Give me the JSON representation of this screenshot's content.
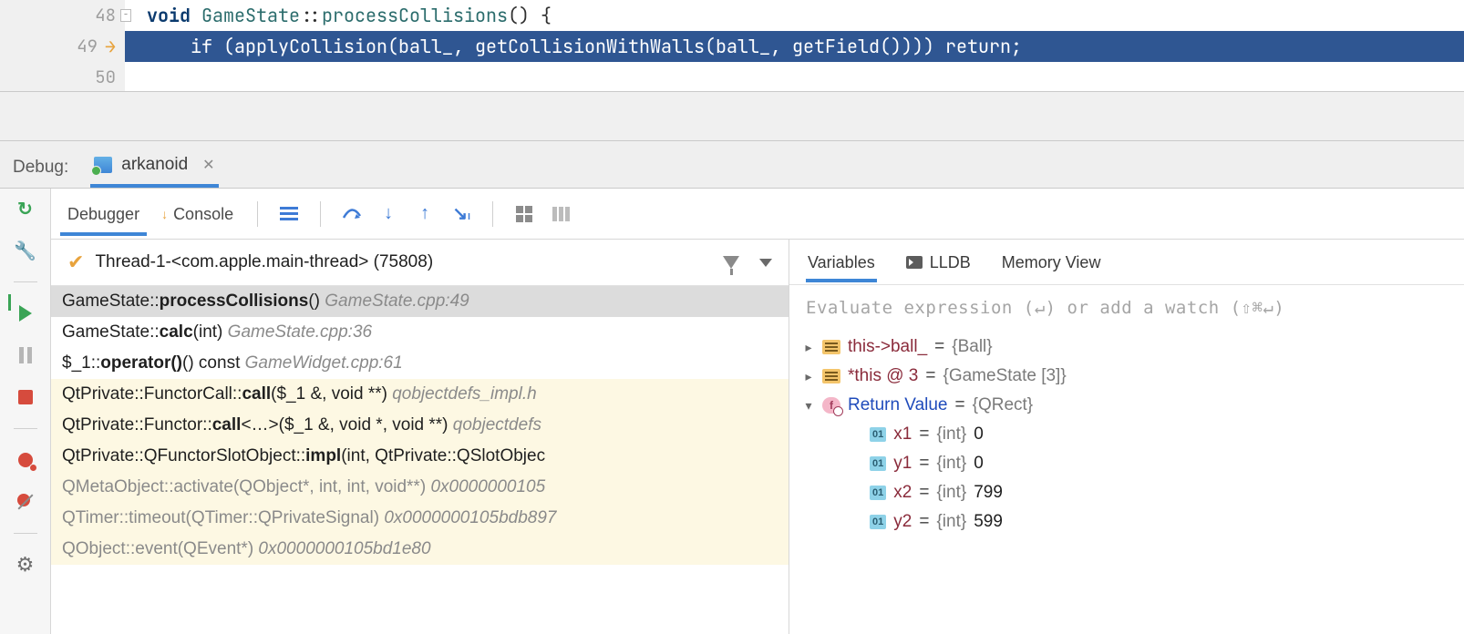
{
  "code": {
    "line48": {
      "num": "48",
      "kw": "void ",
      "cls": "GameState",
      "sep": "::",
      "fn": "processCollisions",
      "rest": "() {"
    },
    "line49": {
      "num": "49",
      "text": "    if (applyCollision(ball_, getCollisionWithWalls(ball_, getField()))) return;"
    },
    "line50": {
      "num": "50"
    }
  },
  "debug": {
    "label": "Debug:",
    "config": "arkanoid"
  },
  "tabs": {
    "debugger": "Debugger",
    "console": "Console"
  },
  "thread": {
    "name": "Thread-1-<com.apple.main-thread> (75808)"
  },
  "frames": [
    {
      "pre": "GameState::",
      "bold": "processCollisions",
      "args": "()",
      "loc": " GameState.cpp:49",
      "sel": true,
      "lib": false
    },
    {
      "pre": "GameState::",
      "bold": "calc",
      "args": "(int)",
      "loc": " GameState.cpp:36",
      "sel": false,
      "lib": false
    },
    {
      "pre": "$_1::",
      "bold": "operator()",
      "args": "() const",
      "loc": " GameWidget.cpp:61",
      "sel": false,
      "lib": false
    },
    {
      "pre": "QtPrivate::FunctorCall::",
      "bold": "call",
      "args": "($_1 &, void **)",
      "loc": " qobjectdefs_impl.h",
      "sel": false,
      "lib": true
    },
    {
      "pre": "QtPrivate::Functor::",
      "bold": "call",
      "args": "<…>($_1 &, void *, void **)",
      "loc": " qobjectdefs",
      "sel": false,
      "lib": true
    },
    {
      "pre": "QtPrivate::QFunctorSlotObject::",
      "bold": "impl",
      "args": "(int, QtPrivate::QSlotObjec",
      "loc": "",
      "sel": false,
      "lib": true
    },
    {
      "pre": "QMetaObject::activate(QObject*, int, int, void**) ",
      "bold": "",
      "args": "",
      "loc": "0x0000000105",
      "sel": false,
      "lib": true,
      "gray": true
    },
    {
      "pre": "QTimer::timeout(QTimer::QPrivateSignal) ",
      "bold": "",
      "args": "",
      "loc": "0x0000000105bdb897",
      "sel": false,
      "lib": true,
      "gray": true
    },
    {
      "pre": "QObject::event(QEvent*) ",
      "bold": "",
      "args": "",
      "loc": "0x0000000105bd1e80",
      "sel": false,
      "lib": true,
      "gray": true
    }
  ],
  "varTabs": {
    "variables": "Variables",
    "lldb": "LLDB",
    "mem": "Memory View"
  },
  "watchHint": "Evaluate expression (↵) or add a watch (⇧⌘↵)",
  "vars": {
    "ball": {
      "name": "this->ball_",
      "sep": " = ",
      "type": "{Ball}"
    },
    "self": {
      "name": "*this @ 3",
      "sep": " = ",
      "type": "{GameState [3]}"
    },
    "ret": {
      "name": "Return Value",
      "sep": " = ",
      "type": "{QRect}"
    },
    "x1": {
      "name": "x1",
      "sep": " = ",
      "type": "{int} ",
      "val": "0"
    },
    "y1": {
      "name": "y1",
      "sep": " = ",
      "type": "{int} ",
      "val": "0"
    },
    "x2": {
      "name": "x2",
      "sep": " = ",
      "type": "{int} ",
      "val": "799"
    },
    "y2": {
      "name": "y2",
      "sep": " = ",
      "type": "{int} ",
      "val": "599"
    }
  }
}
